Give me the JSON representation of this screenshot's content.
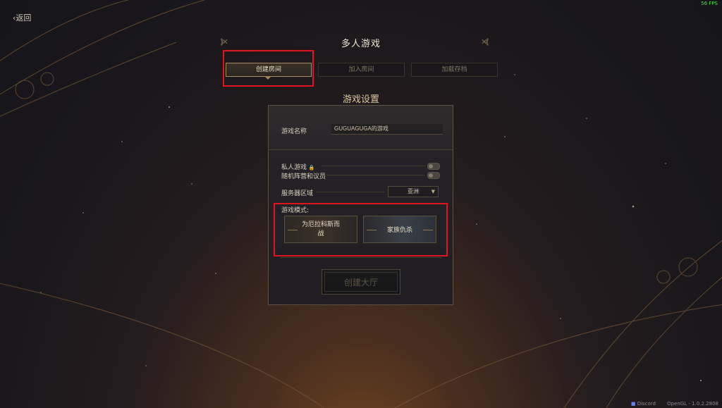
{
  "hud": {
    "fps": "56 FPS"
  },
  "nav": {
    "back_label": "返回"
  },
  "title": "多人游戏",
  "tabs": [
    {
      "label": "创建房间",
      "active": true
    },
    {
      "label": "加入房间",
      "active": false
    },
    {
      "label": "加载存档",
      "active": false
    }
  ],
  "section_title": "游戏设置",
  "settings": {
    "game_name_label": "游戏名称",
    "game_name_value": "GUGUAGUGA的游戏",
    "private_game_label": "私人游戏",
    "random_faction_label": "随机阵营和议员",
    "server_region_label": "服务器区域",
    "server_region_value": "亚洲",
    "game_mode_label": "游戏模式:",
    "modes": [
      {
        "label": "为厄拉科斯而战"
      },
      {
        "label": "家族仇杀"
      }
    ]
  },
  "create_button_label": "创建大厅",
  "footer": {
    "discord": "Discord",
    "version": "OpenGL - 1.0.2.2808"
  },
  "colors": {
    "highlight": "#e0141e",
    "gold": "#a88e5f"
  },
  "icons": {
    "back": "chevron-left-icon",
    "lock": "lock-icon",
    "dropdown": "chevron-down-icon",
    "discord": "discord-icon"
  }
}
